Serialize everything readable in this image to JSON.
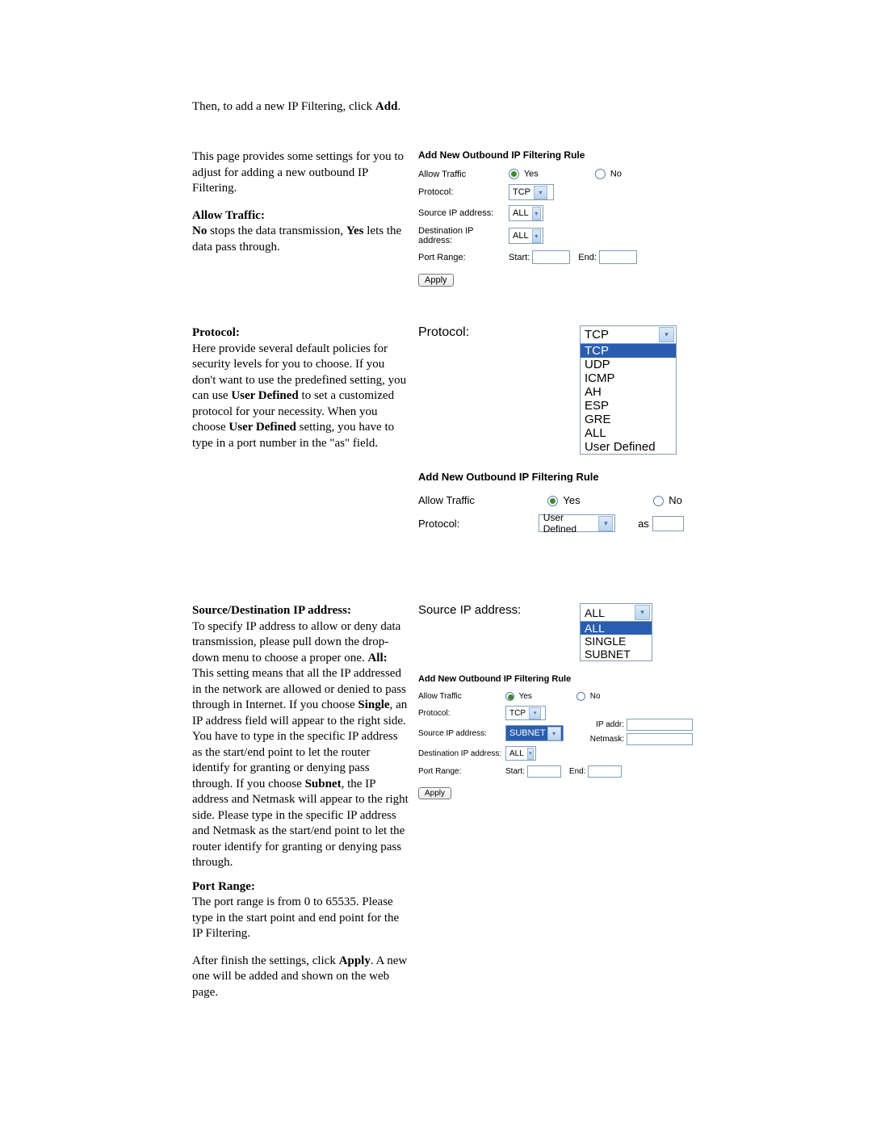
{
  "intro": {
    "line1_a": "Then, to add a new IP Filtering, click ",
    "line1_b": "Add",
    "line2": "This page provides some settings for you to adjust for adding a new outbound IP Filtering."
  },
  "allow_traffic": {
    "heading": "Allow Traffic:",
    "body_a": "No",
    "body_b": " stops the data transmission, ",
    "body_c": "Yes",
    "body_d": " lets the data pass through."
  },
  "protocol_section": {
    "heading": "Protocol:",
    "body_a": "Here provide several default policies for security levels for you to choose. If you don't want to use the predefined setting, you can use ",
    "body_b": "User Defined",
    "body_c": " to set a customized protocol for your necessity. When you choose ",
    "body_d": "User Defined",
    "body_e": " setting, you have to type in a port number in the \"as\" field."
  },
  "srcdst_section": {
    "heading": "Source/Destination IP address:",
    "body_a": "To specify IP address to allow or deny data transmission, please pull down the drop-down menu to choose a proper one. ",
    "body_b": "All:",
    "body_c": " This setting means that all the IP addressed in the network are allowed or denied to pass through in Internet. If you choose ",
    "body_d": "Single",
    "body_e": ", an IP address field will appear to the right side. You have to type in the specific IP address as the start/end point to let the router identify for granting or denying pass through. If you choose ",
    "body_f": "Subnet",
    "body_g": ", the IP address and Netmask will appear to the right side. Please type in the specific IP address and Netmask as the start/end point to let the router identify for granting or denying pass through."
  },
  "port_range_section": {
    "heading": "Port Range:",
    "body": "The port range is from 0 to 65535. Please type in the start point and end point for the IP Filtering."
  },
  "footer": {
    "body_a": "After finish the settings, click ",
    "body_b": "Apply",
    "body_c": ".    A new one will be added and shown on the web page."
  },
  "panel1": {
    "title": "Add New Outbound IP Filtering Rule",
    "labels": {
      "allow": "Allow Traffic",
      "protocol": "Protocol:",
      "src": "Source IP address:",
      "dst": "Destination IP address:",
      "port": "Port Range:",
      "start": "Start:",
      "end": "End:"
    },
    "values": {
      "protocol": "TCP",
      "src": "ALL",
      "dst": "ALL"
    },
    "radio": {
      "yes": "Yes",
      "no": "No"
    },
    "apply": "Apply"
  },
  "proto_dropdown": {
    "label": "Protocol:",
    "head": "TCP",
    "items": [
      "TCP",
      "UDP",
      "ICMP",
      "AH",
      "ESP",
      "GRE",
      "ALL",
      "User Defined"
    ]
  },
  "panel2": {
    "title": "Add New Outbound IP Filtering Rule",
    "labels": {
      "allow": "Allow Traffic",
      "protocol": "Protocol:",
      "as": "as"
    },
    "radio": {
      "yes": "Yes",
      "no": "No"
    },
    "values": {
      "protocol": "User Defined"
    }
  },
  "srcip_dropdown": {
    "label": "Source IP address:",
    "head": "ALL",
    "items": [
      "ALL",
      "SINGLE",
      "SUBNET"
    ]
  },
  "panel3": {
    "title": "Add New Outbound IP Filtering Rule",
    "labels": {
      "allow": "Allow Traffic",
      "protocol": "Protocol:",
      "src": "Source IP address:",
      "dst": "Destination IP address:",
      "port": "Port Range:",
      "start": "Start:",
      "end": "End:",
      "ipaddr": "IP addr:",
      "netmask": "Netmask:"
    },
    "radio": {
      "yes": "Yes",
      "no": "No"
    },
    "values": {
      "protocol": "TCP",
      "src": "SUBNET",
      "dst": "ALL"
    },
    "apply": "Apply"
  }
}
